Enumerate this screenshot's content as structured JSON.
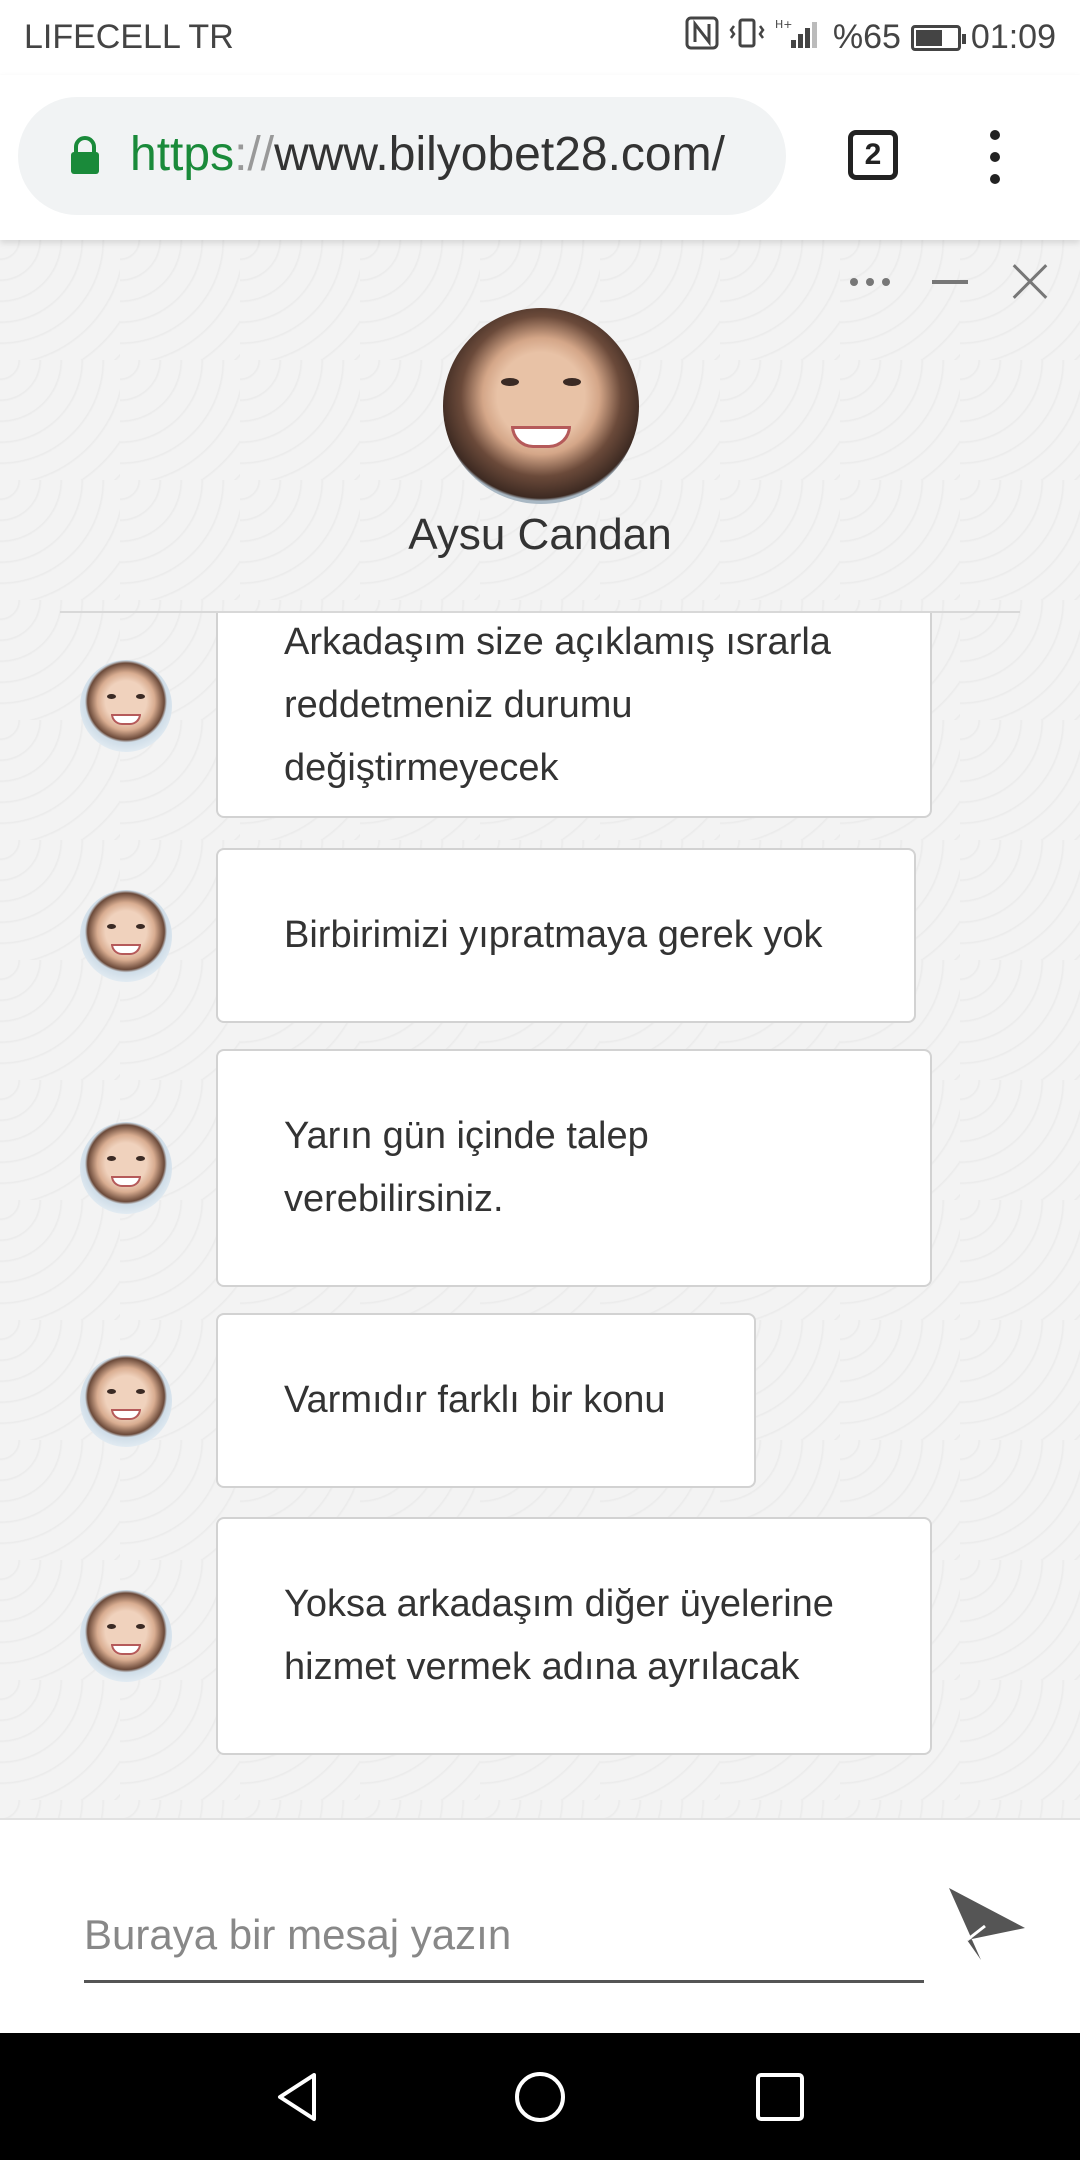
{
  "status_bar": {
    "carrier": "LIFECELL TR",
    "battery": "%65",
    "battery_level": 0.65,
    "time": "01:09"
  },
  "browser": {
    "url_scheme": "https",
    "url_sep": "://",
    "url_rest": "www.bilyobet28.com/",
    "tab_count": "2"
  },
  "chat": {
    "agent_name": "Aysu Candan",
    "messages": [
      {
        "lines": [
          "Arkadaşım size açıklamış ısrarla",
          "reddetmeniz durumu",
          "değiştirmeyecek"
        ]
      },
      {
        "lines": [
          "Birbirimizi yıpratmaya gerek yok"
        ]
      },
      {
        "lines": [
          "Yarın gün içinde talep",
          "verebilirsiniz."
        ]
      },
      {
        "lines": [
          "Varmıdır farklı bir konu"
        ]
      },
      {
        "lines": [
          "Yoksa arkadaşım diğer üyelerine",
          "hizmet vermek adına ayrılacak"
        ]
      }
    ],
    "input_placeholder": "Buraya bir mesaj yazın"
  },
  "colors": {
    "url_secure": "#1a8a3a",
    "chat_background": "#f3f3f3"
  },
  "icons": [
    "lock-icon",
    "tabs-icon",
    "menu-icon",
    "more-icon",
    "minimize-icon",
    "close-icon",
    "send-icon",
    "back-icon",
    "home-icon",
    "recents-icon"
  ]
}
